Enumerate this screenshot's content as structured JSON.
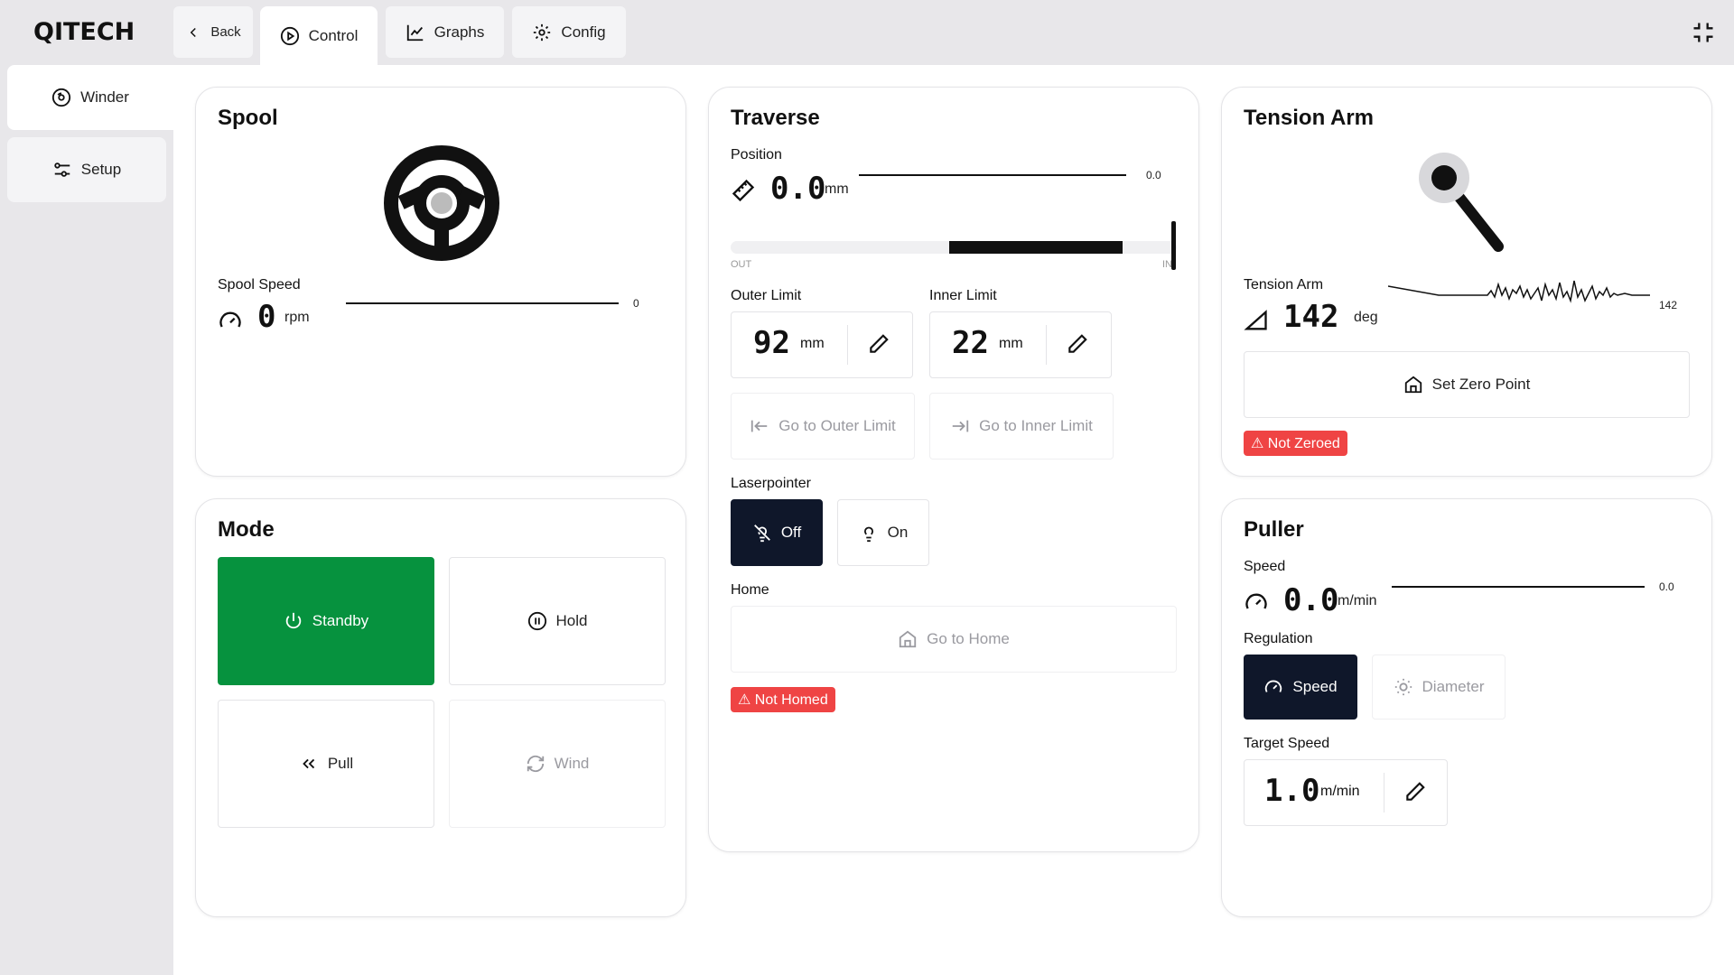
{
  "app": {
    "logo": "QITECH"
  },
  "tabs": {
    "back": "Back",
    "control": "Control",
    "graphs": "Graphs",
    "config": "Config"
  },
  "sidebar": {
    "items": [
      {
        "label": "Winder"
      },
      {
        "label": "Setup"
      }
    ]
  },
  "spool": {
    "title": "Spool",
    "speed_label": "Spool Speed",
    "speed_value": "0",
    "speed_unit": "rpm",
    "spark_value": "0"
  },
  "mode": {
    "title": "Mode",
    "standby": "Standby",
    "hold": "Hold",
    "pull": "Pull",
    "wind": "Wind",
    "active": "Standby",
    "active_color": "#06923e"
  },
  "traverse": {
    "title": "Traverse",
    "position_label": "Position",
    "position_value": "0.0",
    "position_unit": "mm",
    "spark_value": "0.0",
    "range_out": "OUT",
    "range_in": "IN",
    "outer_limit_label": "Outer Limit",
    "outer_limit_value": "92",
    "outer_limit_unit": "mm",
    "inner_limit_label": "Inner Limit",
    "inner_limit_value": "22",
    "inner_limit_unit": "mm",
    "go_outer": "Go to Outer Limit",
    "go_inner": "Go to Inner Limit",
    "laserpointer_label": "Laserpointer",
    "laser_off": "Off",
    "laser_on": "On",
    "home_label": "Home",
    "go_home": "Go to Home",
    "status": "⚠ Not Homed"
  },
  "tension_arm": {
    "title": "Tension Arm",
    "label": "Tension Arm",
    "value": "142",
    "unit": "deg",
    "spark_value": "142",
    "set_zero": "Set Zero Point",
    "status": "⚠ Not Zeroed"
  },
  "puller": {
    "title": "Puller",
    "speed_label": "Speed",
    "speed_value": "0.0",
    "speed_unit": "m/min",
    "spark_value": "0.0",
    "regulation_label": "Regulation",
    "reg_speed": "Speed",
    "reg_diameter": "Diameter",
    "target_label": "Target Speed",
    "target_value": "1.0",
    "target_unit": "m/min"
  },
  "colors": {
    "dark": "#0f172a",
    "green": "#06923e",
    "danger": "#ef4444"
  }
}
